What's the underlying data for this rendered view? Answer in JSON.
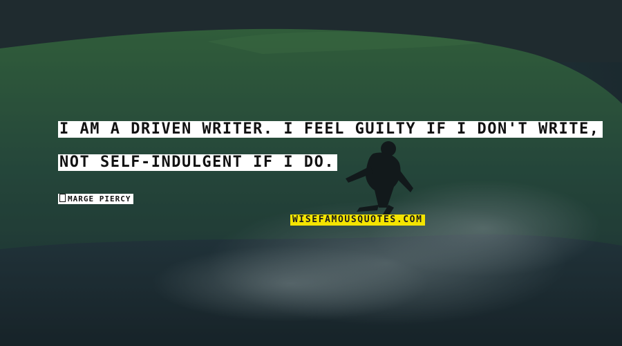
{
  "quote": {
    "line1": "I AM A DRIVEN WRITER. I FEEL GUILTY IF I DON'T WRITE,",
    "line2": "NOT SELF-INDULGENT IF I DO."
  },
  "author": {
    "name": "MARGE PIERCY"
  },
  "watermark": {
    "text": "WISEFAMOUSQUOTES.COM"
  },
  "colors": {
    "quote_background": "#ffffff",
    "watermark_background": "#f4e400",
    "scene_tint": "#24373d"
  }
}
